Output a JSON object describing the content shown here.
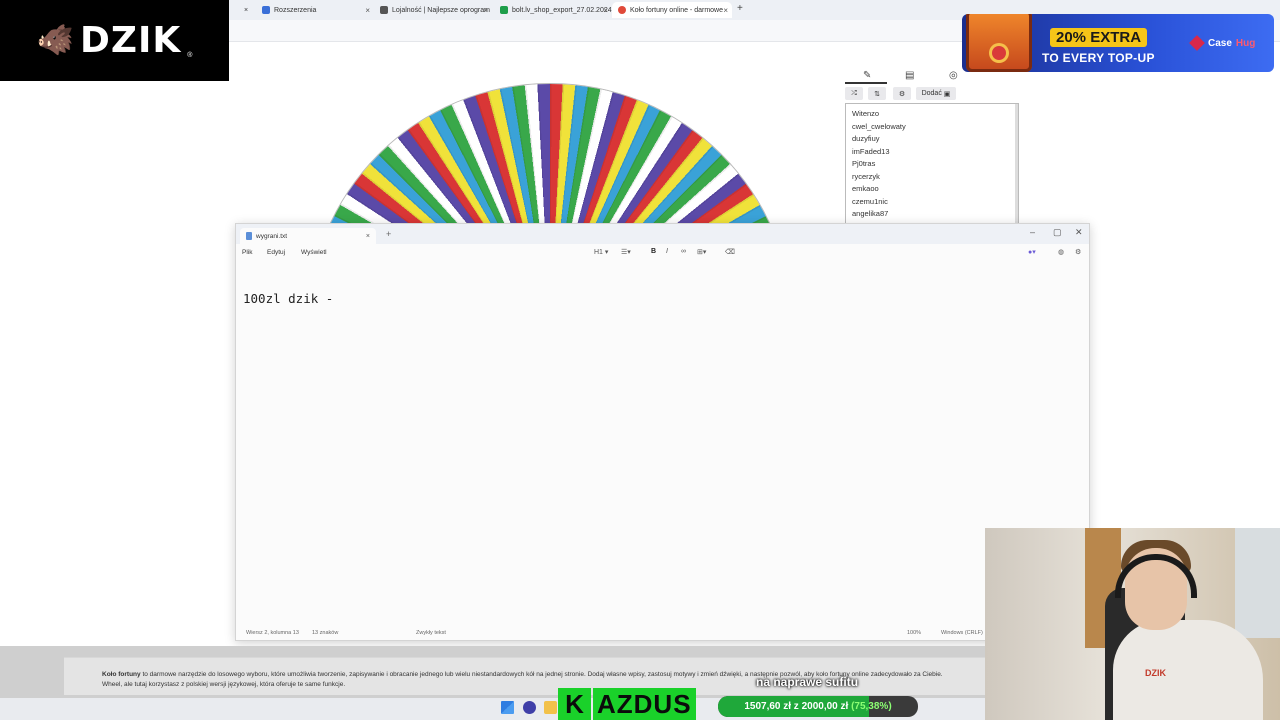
{
  "browser": {
    "tabs": [
      {
        "label": "Rozszerzenia",
        "favicon_color": "#3a6fd8"
      },
      {
        "label": "Lojalność | Najlepsze oprogram",
        "favicon_color": "#555555"
      },
      {
        "label": "bolt.lv_shop_export_27.02.2024",
        "favicon_color": "#1e9e4a"
      },
      {
        "label": "Koło fortuny online - darmowe",
        "favicon_color": "#e04a3a"
      }
    ],
    "close_glyph": "×",
    "newtab_glyph": "+"
  },
  "overlay_logo": {
    "text": "DZIK",
    "reg": "®",
    "icon": "boar-icon"
  },
  "promo": {
    "line1": "20% EXTRA",
    "line2": "TO EVERY TOP-UP",
    "brand_a": "Case",
    "brand_b": "Hug"
  },
  "wheel": {
    "segment_colors": [
      "#d93636",
      "#f0e23a",
      "#3aa2d8",
      "#39a84a",
      "#ffffff",
      "#5b4aa8"
    ]
  },
  "list_panel": {
    "tool_icons": [
      "pencil-icon",
      "clipboard-icon",
      "eye-off-icon"
    ],
    "shuffle_glyph": "⤮",
    "sort_glyph": "⇅",
    "settings_glyph": "⚙",
    "add_label": "Dodać",
    "names": [
      "Witenzo",
      "cwel_cwelowaty",
      "duzyfiuy",
      "imFaded13",
      "Pj0tras",
      "rycerzyk",
      "emkaoo",
      "czemu1nic",
      "angelika87"
    ]
  },
  "notepad": {
    "tab_title": "wygrani.txt",
    "menu": [
      "Plik",
      "Edytuj",
      "Wyświetl"
    ],
    "toolbar": {
      "heading": "H1",
      "bold": "B",
      "italic": "I"
    },
    "content": "100zl dzik -",
    "status": {
      "position": "Wiersz 2, kolumna 13",
      "chars": "13 znaków",
      "format": "Zwykły tekst",
      "zoom": "100%",
      "encoding": "Windows (CRLF)"
    }
  },
  "description": {
    "bold": "Koło fortuny",
    "line1": " to darmowe narzędzie do losowego wyboru, które umożliwia tworzenie, zapisywanie i obracanie jednego lub wielu niestandardowych kół na jednej stronie. Dodaj własne wpisy, zastosuj motywy i zmień dźwięki, a następnie pozwól, aby koło fortuny online zadecydowało za Ciebie.",
    "line2": "Wheel, ale tutaj korzystasz z polskiej wersji językowej, która oferuje te same funkcje."
  },
  "stream": {
    "name_first": "K",
    "name_rest": "AZDUS",
    "goal_title": "na naprawe sufitu",
    "goal_amount": "1507,60 zł z 2000,00 zł",
    "goal_pct_label": "(75,38%)",
    "goal_fraction": 0.7538
  }
}
